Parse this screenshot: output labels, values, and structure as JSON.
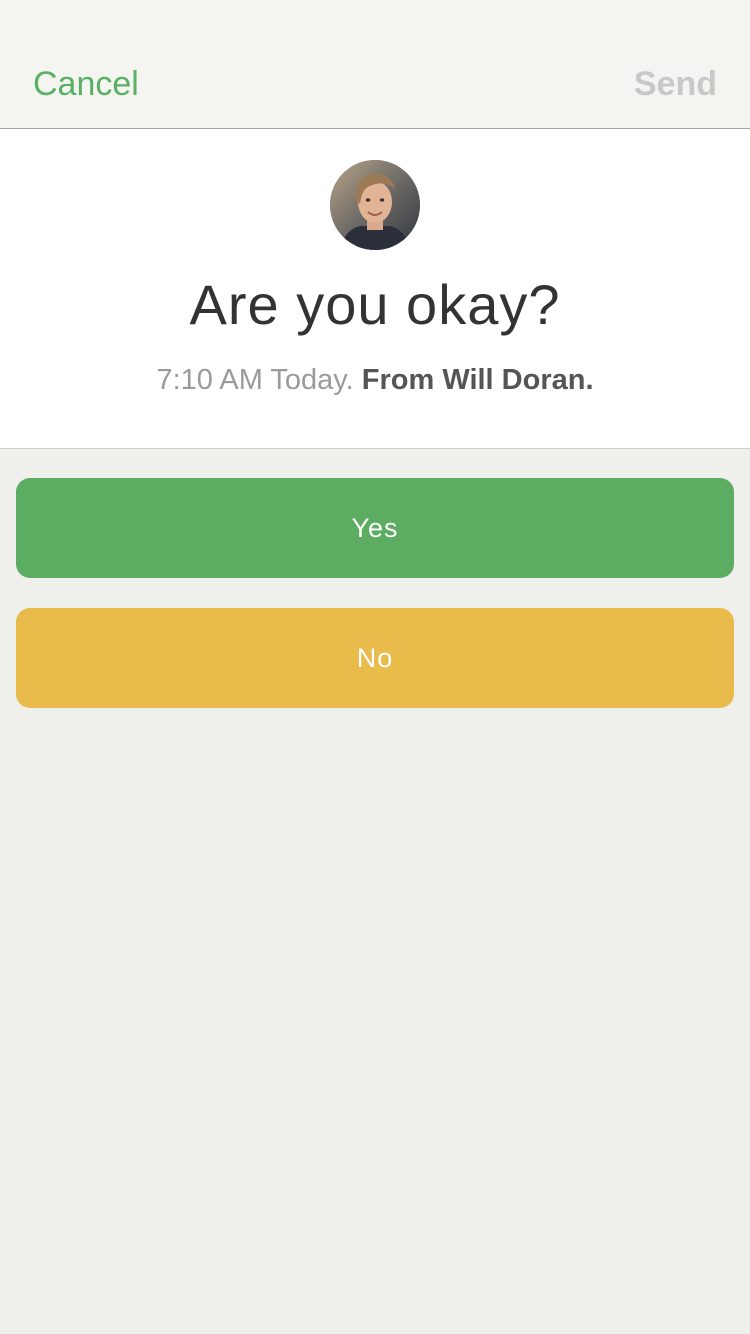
{
  "nav": {
    "cancel_label": "Cancel",
    "send_label": "Send"
  },
  "question": {
    "title": "Are you okay?",
    "time_text": "7:10 AM Today.",
    "from_text": "From Will Doran."
  },
  "options": {
    "yes_label": "Yes",
    "no_label": "No"
  },
  "colors": {
    "accent_green": "#5cad62",
    "accent_yellow": "#e8bb4b",
    "cancel_text": "#5ab064",
    "send_disabled": "#c8c8c8"
  }
}
